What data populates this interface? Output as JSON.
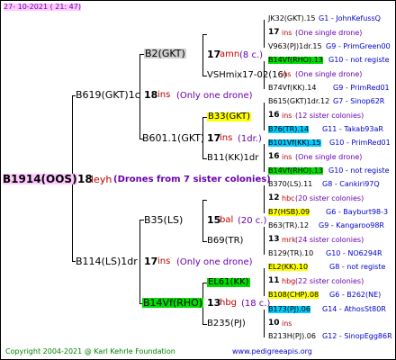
{
  "header": {
    "date": "27- 10-2021 ( 21: 47)"
  },
  "footer": {
    "copyright": "Copyright 2004-2021 @ Karl Kehrle Foundation",
    "site": "www.pedigreeapis.org"
  },
  "root": {
    "id": "B1914(OOS)",
    "num": "18",
    "code": "leyh",
    "note": "(Drones from 7 sister colonies)"
  },
  "gen1": {
    "top": {
      "id": "B619(GKT)1c",
      "num": "18",
      "code": "ins",
      "note": "(Only one drone)"
    },
    "bottom": {
      "id": "B114(LS)1dr",
      "num": "17",
      "code": "ins",
      "note": "(Only one drone)"
    }
  },
  "gen2": {
    "a": {
      "id": "B2(GKT)"
    },
    "b": {
      "id": "B601.1(GKT)",
      "num": "17",
      "code": "ins",
      "note": "(1dr.)"
    },
    "c": {
      "id": "B35(LS)"
    },
    "d": {
      "id": "B14Vf(RHO)"
    }
  },
  "gen3": {
    "a": {
      "num": "17",
      "code": "amn",
      "note": "(8 c.)"
    },
    "b": {
      "id": "VSHmix17-02(16)"
    },
    "c": {
      "id": "B33(GKT)"
    },
    "d": {
      "id": "B11(KK)1dr",
      "num": "17",
      "code": "ins"
    },
    "e": {
      "num": "15",
      "code": "bal",
      "note": "(20 c.)"
    },
    "f": {
      "id": "B69(TR)"
    },
    "g": {
      "id": "EL61(KK)"
    },
    "h": {
      "num": "13",
      "code": "hbg",
      "note": "(18 c.)"
    },
    "i": {
      "id": "B235(PJ)"
    }
  },
  "gen4": [
    {
      "id": "JK32(GKT).15",
      "g": "G1 - JohnKefussQ"
    },
    {
      "num": "17",
      "code": "ins",
      "note": "(One single drone)"
    },
    {
      "id": "V963(PJ)1dr.15",
      "g": "G9 - PrimGreen00"
    },
    {
      "id": "B14Vf(RHO).13",
      "g": "G10 - not registe"
    },
    {
      "code": "ins",
      "note": "(One single drone)"
    },
    {
      "id": "B74Vf(KK).14",
      "g": "G9 - PrimRed01"
    },
    {
      "id": "B615(GKT)1dr.12",
      "g": "G7 - Sinop62R"
    },
    {
      "num": "16",
      "code": "ins",
      "note": "(12 sister colonies)"
    },
    {
      "id": "B76(TR).14",
      "g": "G11 - Takab93aR"
    },
    {
      "id": "B101Vf(KK).15",
      "g": "G10 - PrimRed01"
    },
    {
      "num": "16",
      "code": "ins",
      "note": "(One single drone)"
    },
    {
      "id": "B14Vf(RHO).13",
      "g": "G10 - not registe"
    },
    {
      "id": "B370(LS).11",
      "g": "G8 - Cankiri97Q"
    },
    {
      "num": "12",
      "code": "hbc",
      "note": "(20 sister colonies)"
    },
    {
      "id": "B7(HSB).09",
      "g": "G6 - Bayburt98-3"
    },
    {
      "id": "B63(TR).12",
      "g": "G9 - Kangaroo98R"
    },
    {
      "num": "13",
      "code": "mrk",
      "note": "(24 sister colonies)"
    },
    {
      "id": "B129(TR).10",
      "g": "G10 - NO6294R"
    },
    {
      "id": "EL2(KK).10",
      "g": "G8 - not registe"
    },
    {
      "num": "11",
      "code": "hbg",
      "note": "(22 sister colonies)"
    },
    {
      "id": "B108(CHP).08",
      "g": "G6 - B262(NE)"
    },
    {
      "id": "B173(PJ).06",
      "g": "G14 - AthosSt80R"
    },
    {
      "num": "10",
      "code": "ins"
    },
    {
      "id": "B213H(PJ).06",
      "g": "G12 - SinopEgg86R"
    }
  ]
}
